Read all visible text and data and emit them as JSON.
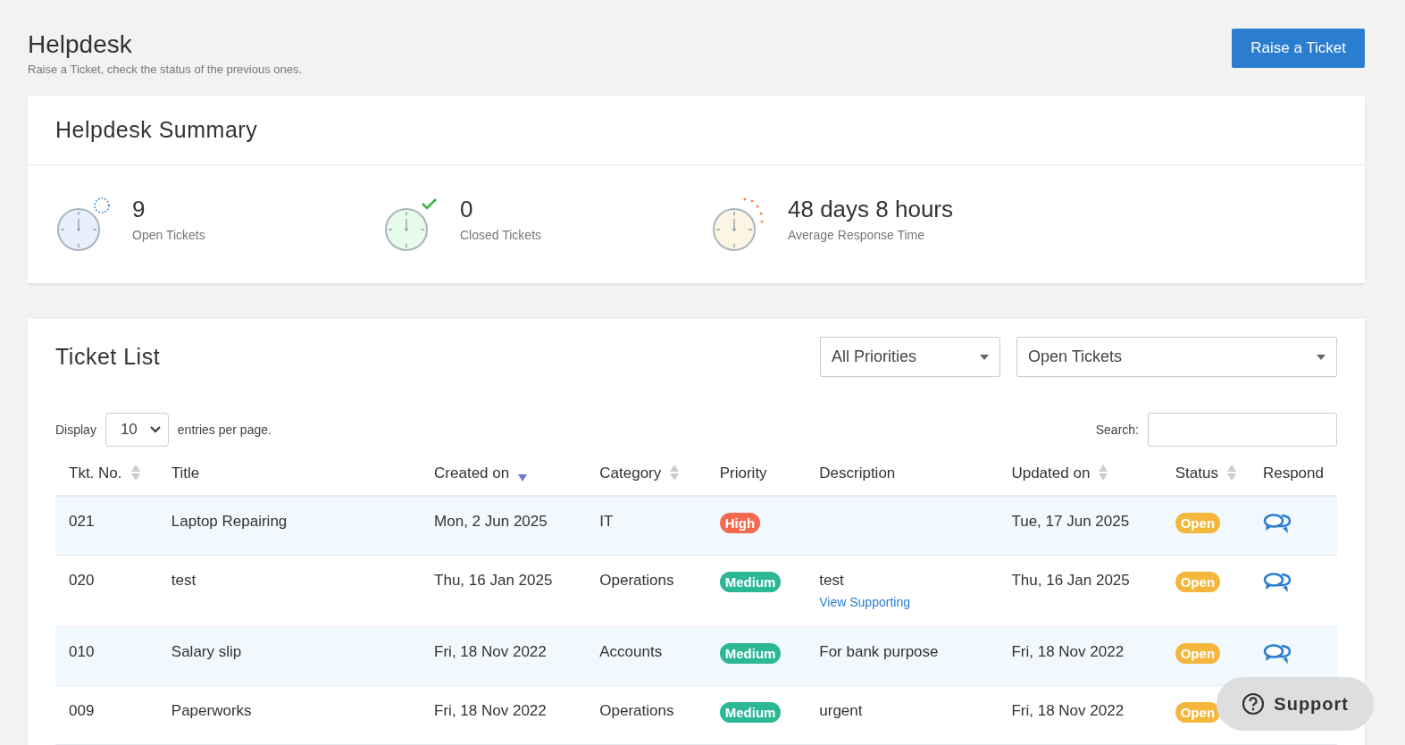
{
  "header": {
    "title": "Helpdesk",
    "subtitle": "Raise a Ticket, check the status of the previous ones.",
    "action": "Raise a Ticket"
  },
  "summary": {
    "title": "Helpdesk Summary",
    "stats": [
      {
        "kind": "open",
        "value": "9",
        "label": "Open Tickets"
      },
      {
        "kind": "closed",
        "value": "0",
        "label": "Closed Tickets"
      },
      {
        "kind": "response",
        "value": "48 days 8 hours",
        "label": "Average Response Time"
      }
    ]
  },
  "ticket_list": {
    "title": "Ticket List",
    "filters": [
      {
        "value": "All Priorities"
      },
      {
        "value": "Open Tickets"
      }
    ],
    "display_label": "Display",
    "page_size": "10",
    "entries_label": "entries per page.",
    "search_label": "Search:",
    "columns": [
      {
        "label": "Tkt. No.",
        "sortable": true,
        "selected": false
      },
      {
        "label": "Title",
        "sortable": false,
        "selected": false
      },
      {
        "label": "Created on",
        "sortable": true,
        "selected": true
      },
      {
        "label": "Category",
        "sortable": true,
        "selected": false
      },
      {
        "label": "Priority",
        "sortable": false,
        "selected": false
      },
      {
        "label": "Description",
        "sortable": false,
        "selected": false
      },
      {
        "label": "Updated on",
        "sortable": true,
        "selected": false
      },
      {
        "label": "Status",
        "sortable": true,
        "selected": false
      },
      {
        "label": "Respond",
        "sortable": false,
        "selected": false
      }
    ],
    "rows": [
      {
        "no": "021",
        "title": "Laptop Repairing",
        "created": "Mon, 2 Jun 2025",
        "category": "IT",
        "priority": {
          "text": "High",
          "color": "#f36a4f"
        },
        "updated": "Tue, 17 Jun 2025",
        "status": {
          "text": "Open",
          "color": "#f5b73b"
        }
      },
      {
        "no": "020",
        "title": "test",
        "created": "Thu, 16 Jan 2025",
        "category": "Operations",
        "priority": {
          "text": "Medium",
          "color": "#2cb795"
        },
        "description": "test",
        "link": "View Supporting",
        "updated": "Thu, 16 Jan 2025",
        "status": {
          "text": "Open",
          "color": "#f5b73b"
        }
      },
      {
        "no": "010",
        "title": "Salary slip",
        "created": "Fri, 18 Nov 2022",
        "category": "Accounts",
        "priority": {
          "text": "Medium",
          "color": "#2cb795"
        },
        "description": "For bank purpose",
        "updated": "Fri, 18 Nov 2022",
        "status": {
          "text": "Open",
          "color": "#f5b73b"
        }
      },
      {
        "no": "009",
        "title": "Paperworks",
        "created": "Fri, 18 Nov 2022",
        "category": "Operations",
        "priority": {
          "text": "Medium",
          "color": "#2cb795"
        },
        "description": "urgent",
        "updated": "Fri, 18 Nov 2022",
        "status": {
          "text": "Open",
          "color": "#f5b73b"
        }
      }
    ]
  },
  "support_button": "Support"
}
